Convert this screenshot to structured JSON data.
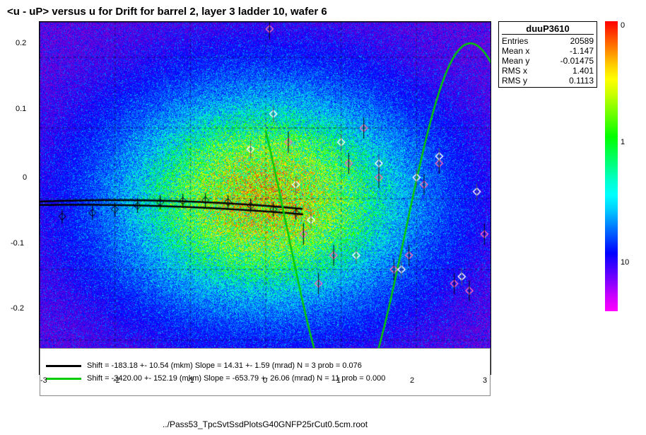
{
  "title": "<u - uP>      versus   u for Drift for barrel 2, layer 3 ladder 10, wafer 6",
  "legend": {
    "title": "duuP3610",
    "entries": [
      {
        "label": "Entries",
        "value": "20589"
      },
      {
        "label": "Mean x",
        "value": "-1.147"
      },
      {
        "label": "Mean y",
        "value": "-0.01475"
      },
      {
        "label": "RMS x",
        "value": "1.401"
      },
      {
        "label": "RMS y",
        "value": "0.1113"
      }
    ]
  },
  "scale_labels": [
    "0",
    "1",
    "10"
  ],
  "x_axis": {
    "label": "../Pass53_TpcSvtSsdPlotsG40GNFP25rCut0.5cm.root",
    "ticks": [
      "-3",
      "-2",
      "-1",
      "0",
      "1",
      "2",
      "3"
    ]
  },
  "y_axis": {
    "ticks": [
      "0.2",
      "0.1",
      "0",
      "-0.1",
      "-0.2"
    ]
  },
  "fit_lines": [
    {
      "color": "black",
      "label": "Shift = -183.18 +- 10.54 (mkm) Slope =   14.31 +- 1.59 (mrad)  N = 3 prob = 0.076"
    },
    {
      "color": "green",
      "label": "Shift = -3420.00 +- 152.19 (mkm) Slope = -653.79 +- 26.06 (mrad)  N = 11 prob = 0.000"
    }
  ]
}
